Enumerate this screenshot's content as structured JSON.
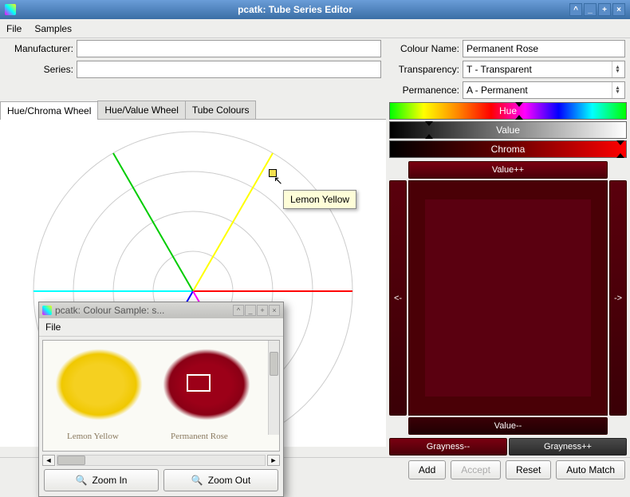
{
  "window": {
    "title": "pcatk: Tube Series Editor"
  },
  "menubar": {
    "file": "File",
    "samples": "Samples"
  },
  "form": {
    "manufacturer_label": "Manufacturer:",
    "manufacturer_value": "",
    "series_label": "Series:",
    "series_value": "",
    "colour_name_label": "Colour Name:",
    "colour_name_value": "Permanent Rose",
    "transparency_label": "Transparency:",
    "transparency_value": "T     - Transparent",
    "permanence_label": "Permanence:",
    "permanence_value": "A     - Permanent"
  },
  "tabs": {
    "hue_chroma": "Hue/Chroma Wheel",
    "hue_value": "Hue/Value Wheel",
    "tube_colours": "Tube Colours"
  },
  "wheel": {
    "tooltip": "Lemon Yellow"
  },
  "sample_window": {
    "title": "pcatk: Colour Sample: s...",
    "menu_file": "File",
    "label_yellow": "Lemon Yellow",
    "label_red": "Permanent Rose",
    "zoom_in": "Zoom In",
    "zoom_out": "Zoom Out"
  },
  "sliders": {
    "hue": "Hue",
    "value": "Value",
    "chroma": "Chroma"
  },
  "colour_panel": {
    "value_plus": "Value++",
    "value_minus": "Value--",
    "left": "<-",
    "right": "->",
    "grayness_minus": "Grayness--",
    "grayness_plus": "Grayness++"
  },
  "buttons": {
    "add": "Add",
    "accept": "Accept",
    "reset": "Reset",
    "auto_match": "Auto Match"
  }
}
